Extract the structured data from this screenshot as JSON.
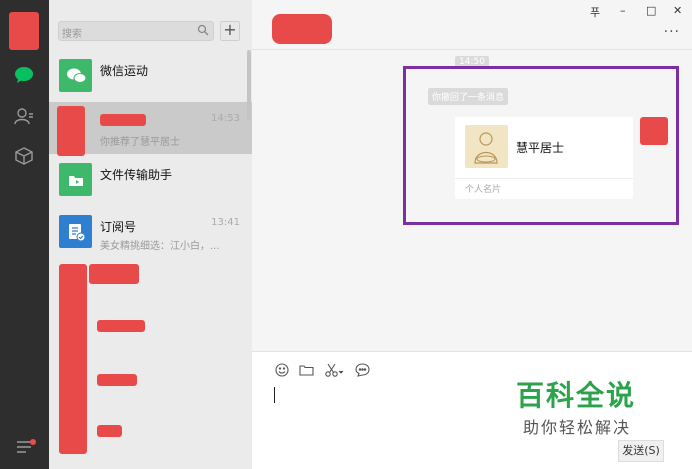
{
  "sidebar": {
    "icons": [
      "avatar",
      "chat-bubble-icon",
      "contacts-icon",
      "favorites-box-icon",
      "menu-icon"
    ]
  },
  "search": {
    "placeholder": "搜索"
  },
  "conversations": [
    {
      "title": "微信运动",
      "subtitle": "",
      "time": "",
      "icon_color": "#3eb96b"
    },
    {
      "title": "",
      "subtitle": "你推荐了慧平居士",
      "time": "14:53",
      "icon_color": "#e84a4a"
    },
    {
      "title": "文件传输助手",
      "subtitle": "",
      "time": "",
      "icon_color": "#3eb96b"
    },
    {
      "title": "订阅号",
      "subtitle": "美女精挑细选：江小白，...",
      "time": "13:41",
      "icon_color": "#2f7fd0"
    }
  ],
  "chat": {
    "time_label": "14:50",
    "system_message": "你撤回了一条消息",
    "card": {
      "name": "慧平居士",
      "kind": "个人名片"
    }
  },
  "window_controls": {
    "pin": "푸",
    "minimize": "–",
    "maximize": "□",
    "close": "✕"
  },
  "input": {
    "send_label": "发送(S)"
  },
  "watermark": {
    "title": "百科全说",
    "subtitle": "助你轻松解决"
  },
  "colors": {
    "highlight": "#7a2fa3",
    "wechat_green": "#3eb96b",
    "redaction": "#e84a4a"
  }
}
